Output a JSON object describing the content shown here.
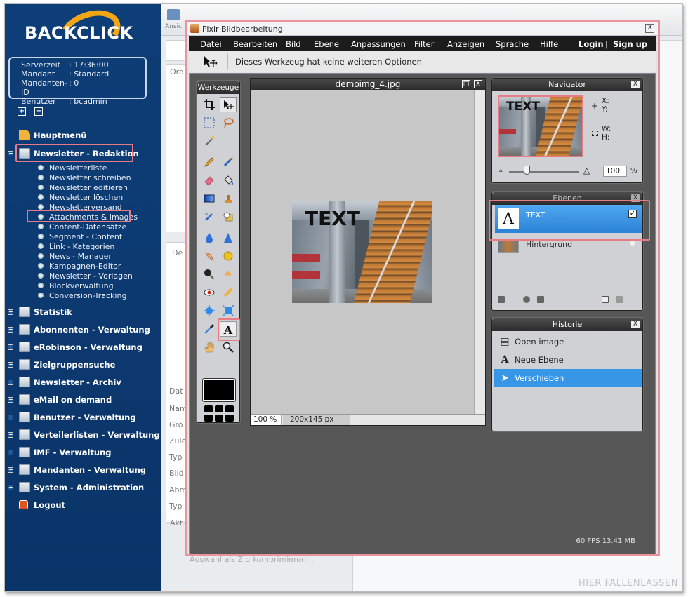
{
  "sidebar": {
    "logo_text": "BACKCLICK",
    "info": [
      {
        "key": "Serverzeit",
        "value": ": 17:36:00"
      },
      {
        "key": "Mandant",
        "value": ": Standard"
      },
      {
        "key": "Mandanten-ID",
        "value": ": 0"
      },
      {
        "key": "Benutzer",
        "value": ": bcadmin"
      }
    ],
    "expand_symbol": "+",
    "collapse_symbol": "−",
    "menu": {
      "hauptmenue": "Hauptmenü",
      "newsletter_redaktion": "Newsletter - Redaktion",
      "statistik": "Statistik",
      "abonnenten": "Abonnenten - Verwaltung",
      "erobinson": "eRobinson - Verwaltung",
      "zielgruppensuche": "Zielgruppensuche",
      "archiv": "Newsletter - Archiv",
      "email_on_demand": "eMail on demand",
      "benutzer": "Benutzer - Verwaltung",
      "verteilerlisten": "Verteilerlisten - Verwaltung",
      "imf": "IMF - Verwaltung",
      "mandanten": "Mandanten - Verwaltung",
      "system": "System - Administration",
      "logout": "Logout"
    },
    "submenu": [
      "Newsletterliste",
      "Newsletter schreiben",
      "Newsletter editieren",
      "Newsletter löschen",
      "Newsletterversand",
      "Attachments & Images",
      "Content-Datensätze",
      "Segment - Content",
      "Link - Kategorien",
      "News - Manager",
      "Kampagnen-Editor",
      "Newsletter - Vorlagen",
      "Blockverwaltung",
      "Conversion-Tracking"
    ]
  },
  "background": {
    "toolbar_label": "Ansic",
    "left_panel_top_label": "Ord",
    "details_tab": "De",
    "form_labels": [
      "Dat",
      "Nam",
      "Grö",
      "Zule",
      "Typ",
      "Bild",
      "Abm",
      "Typ",
      "Akt"
    ],
    "zip_action": "Auswahl als Zip komprimieren...",
    "dropzone": "HIER FALLENLASSEN"
  },
  "pixlr": {
    "title": "Pixlr Bildbearbeitung",
    "close": "X",
    "menu": {
      "datei": "Datei",
      "bearbeiten": "Bearbeiten",
      "bild": "Bild",
      "ebene": "Ebene",
      "anpassungen": "Anpassungen",
      "filter": "Filter",
      "anzeigen": "Anzeigen",
      "sprache": "Sprache",
      "hilfe": "Hilfe",
      "login": "Login",
      "separator": "|",
      "signup": "Sign up"
    },
    "tool_options": "Dieses Werkzeug hat keine weiteren Optionen",
    "tools_panel_title": "Werkzeuge",
    "canvas": {
      "filename": "demoimg_4.jpg",
      "zoom": "100 %",
      "dimensions": "200x145 px",
      "image_text": "TEXT"
    },
    "navigator": {
      "title": "Navigator",
      "x_label": "X:",
      "y_label": "Y:",
      "w_label": "W:",
      "h_label": "H:",
      "zoom_value": "100",
      "zoom_unit": "%",
      "zoom_level": 0.25
    },
    "layers": {
      "title": "Ebenen",
      "items": [
        {
          "name": "TEXT",
          "selected": true
        },
        {
          "name": "Hintergrund",
          "selected": false
        }
      ],
      "text_layer_thumb": "A"
    },
    "history": {
      "title": "Historie",
      "items": [
        {
          "label": "Open image",
          "selected": false
        },
        {
          "label": "Neue Ebene",
          "selected": false
        },
        {
          "label": "Verschieben",
          "selected": true
        }
      ]
    },
    "status": "60 FPS 13.41 MB",
    "colors": {
      "highlight": "#3796e6",
      "accent_outline": "#e87b84"
    }
  }
}
